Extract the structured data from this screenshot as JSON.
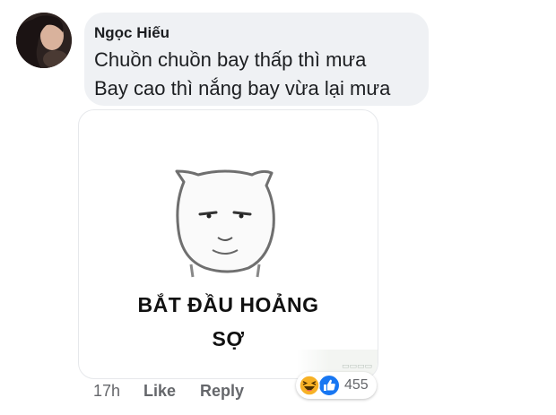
{
  "comment": {
    "author": "Ngọc Hiếu",
    "lines": [
      "Chuồn chuồn bay thấp thì mưa",
      "Bay cao thì nắng bay vừa lại mưa"
    ]
  },
  "media": {
    "caption_lines": [
      "BẮT ĐẦU HOẢNG",
      "SỢ"
    ]
  },
  "actions": {
    "time": "17h",
    "like_label": "Like",
    "reply_label": "Reply"
  },
  "reactions": {
    "icons": [
      "haha-icon",
      "like-icon"
    ],
    "count": "455",
    "like_color": "#1877f2",
    "haha_color": "#f7b125"
  }
}
